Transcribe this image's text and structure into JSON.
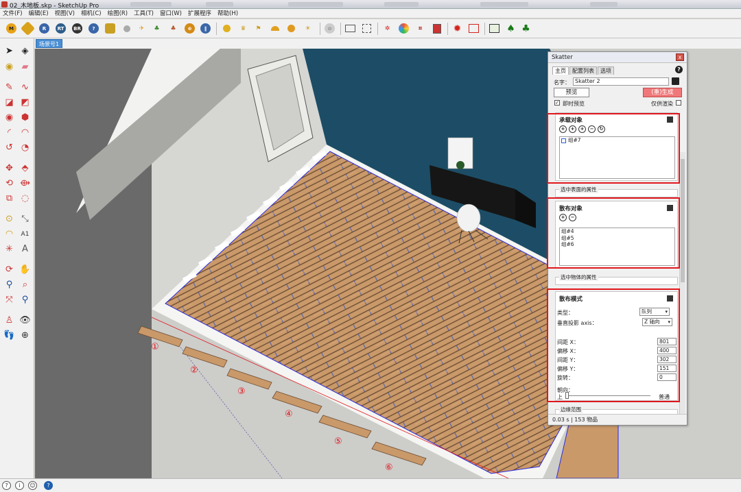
{
  "app": {
    "title": "02_木地板.skp - SketchUp Pro"
  },
  "menu": [
    "文件(F)",
    "编辑(E)",
    "视图(V)",
    "相机(C)",
    "绘图(R)",
    "工具(T)",
    "窗口(W)",
    "扩展程序",
    "帮助(H)"
  ],
  "scene_tab": "场景号1",
  "skatter": {
    "title": "Skatter",
    "close": "x",
    "tabs": [
      "主页",
      "配置列表",
      "选项"
    ],
    "help": "?",
    "name_label": "名字：",
    "name_value": "Skatter 2",
    "preview_btn": "预览",
    "generate_btn": "(重)生成",
    "live_preview": "即时预览",
    "proxy_only": "仅供渲染",
    "host": {
      "header": "承载对象",
      "icons": [
        "+",
        "+",
        "+",
        "−",
        "↻"
      ],
      "items": [
        "组#7"
      ],
      "attr_label": "选中表面的属性"
    },
    "scatter_obj": {
      "header": "散布对象",
      "icons": [
        "+",
        "−"
      ],
      "items": [
        "组#4",
        "组#5",
        "组#6"
      ],
      "attr_label": "选中物体的属性"
    },
    "mode": {
      "header": "散布模式",
      "type_label": "类型：",
      "type_value": "队列",
      "proj_label": "垂直投影 axis：",
      "proj_value": "Z 轴向",
      "fields": [
        {
          "label": "间距 X：",
          "value": "801"
        },
        {
          "label": "偏移 X：",
          "value": "400"
        },
        {
          "label": "间距 Y：",
          "value": "302"
        },
        {
          "label": "偏移 Y：",
          "value": "151"
        },
        {
          "label": "旋转：",
          "value": "0"
        }
      ],
      "orient_label": "朝向：",
      "orient_left": "上",
      "orient_right": "普通",
      "boundary_label": "边缘范围"
    },
    "footer": "0.03 s | 153 物品"
  },
  "callouts": [
    "①",
    "②",
    "③",
    "④",
    "⑤",
    "⑥"
  ],
  "colors": {
    "accent_red": "#e0161c",
    "floor_wood": "#c89a6e",
    "wall_blue": "#1f4e67",
    "scene_tab": "#4a8fd4"
  }
}
